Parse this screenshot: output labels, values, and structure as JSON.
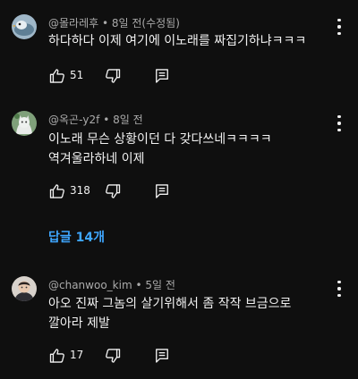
{
  "comments": [
    {
      "author": "@몰라레후",
      "time": "8일 전(수정됨)",
      "lines": [
        "하다하다  이제 여기에  이노래를 짜집기하냐ㅋㅋㅋ"
      ],
      "likes": "51",
      "avatar_icon": "bird-avatar-icon"
    },
    {
      "author": "@옥곤-y2f",
      "time": "8일 전",
      "lines": [
        "이노래 무슨 상황이던 다 갖다쓰네ㅋㅋㅋㅋ",
        "역겨울라하네 이제"
      ],
      "likes": "318",
      "avatar_icon": "cat-avatar-icon"
    },
    {
      "author": "@chanwoo_kim",
      "time": "5일 전",
      "lines": [
        "아오 진짜 그놈의 살기위해서 좀 작작 브금으로",
        "깔아라 제발"
      ],
      "likes": "17",
      "avatar_icon": "person-avatar-icon"
    }
  ],
  "replies": {
    "label": "답글 14개"
  },
  "separator": " • ",
  "colors": {
    "background": "#0f0f0f",
    "text": "#f1f1f1",
    "meta": "#aaaaaa",
    "link": "#3ea6ff"
  }
}
